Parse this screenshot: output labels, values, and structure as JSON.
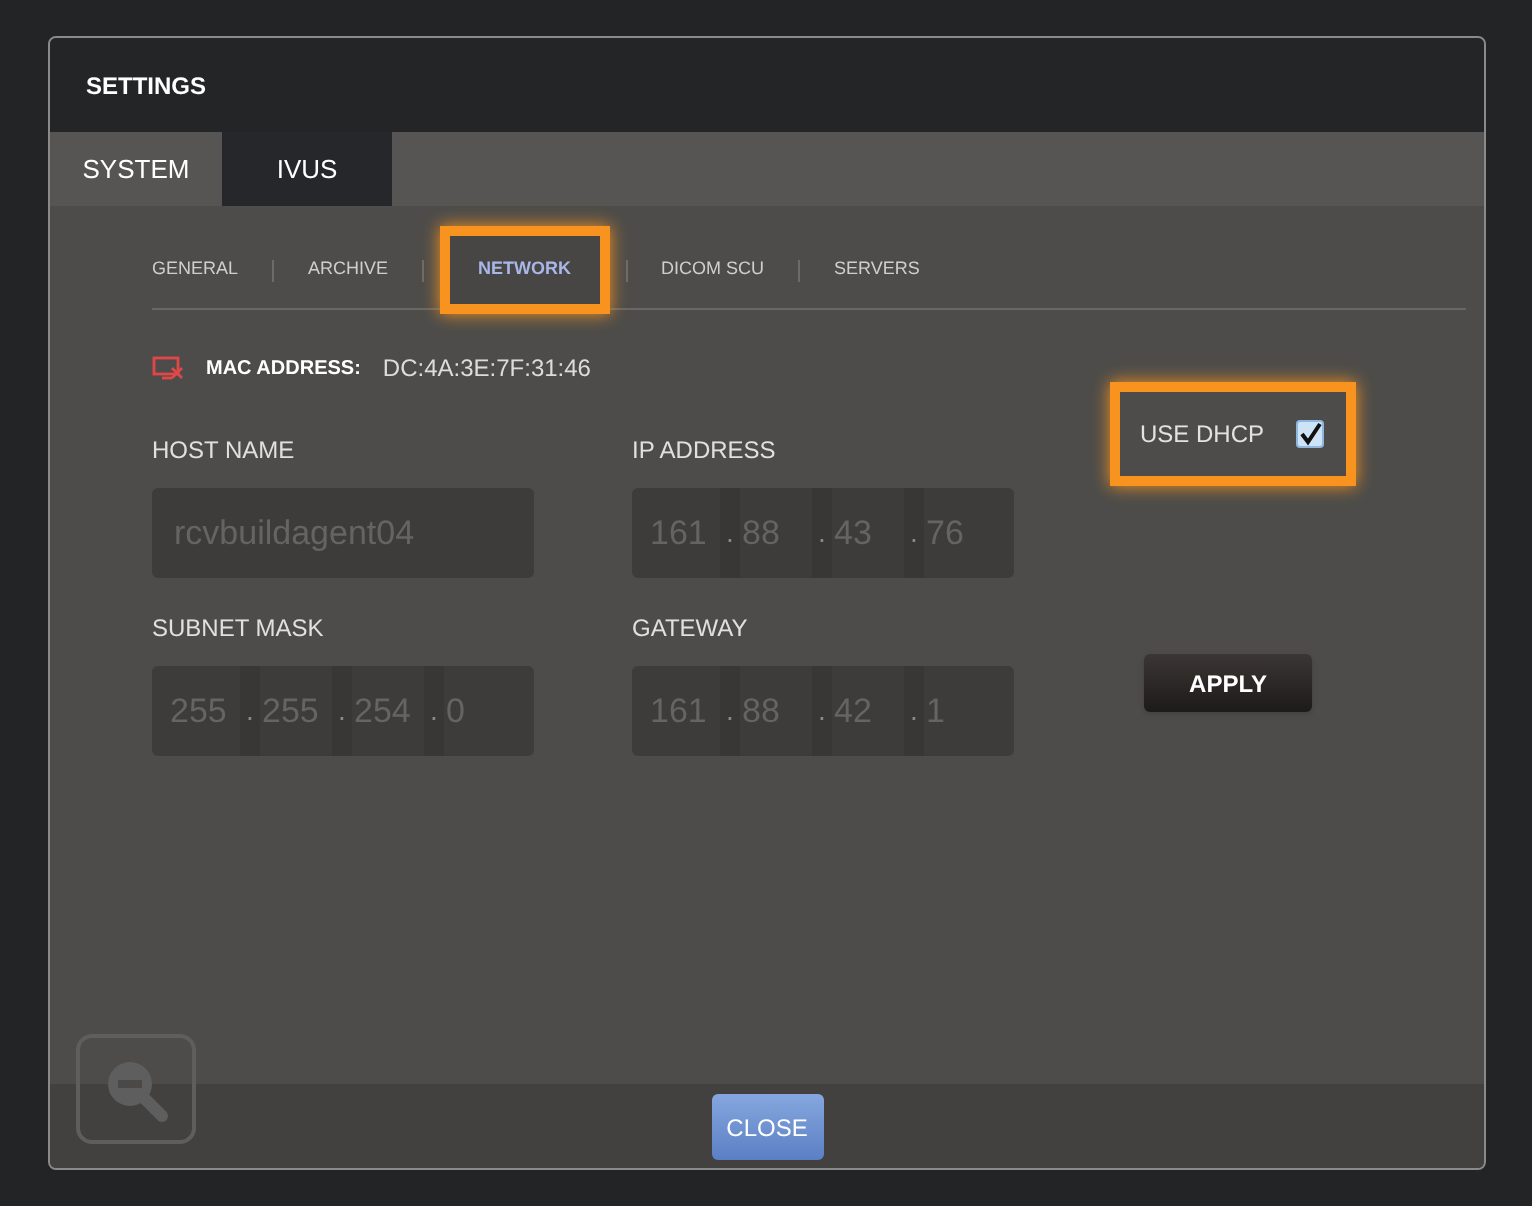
{
  "window": {
    "title": "SETTINGS"
  },
  "tabs": [
    {
      "label": "SYSTEM",
      "selected": false
    },
    {
      "label": "IVUS",
      "selected": true
    }
  ],
  "subtabs": [
    {
      "label": "GENERAL",
      "selected": false,
      "highlighted": false
    },
    {
      "label": "ARCHIVE",
      "selected": false,
      "highlighted": false
    },
    {
      "label": "NETWORK",
      "selected": true,
      "highlighted": true
    },
    {
      "label": "DICOM SCU",
      "selected": false,
      "highlighted": false
    },
    {
      "label": "SERVERS",
      "selected": false,
      "highlighted": false
    }
  ],
  "mac": {
    "label": "MAC ADDRESS:",
    "value": "DC:4A:3E:7F:31:46"
  },
  "octet_separator": ".",
  "fields": [
    {
      "label": "HOST NAME",
      "kind": "text",
      "value": "rcvbuildagent04"
    },
    {
      "label": "IP ADDRESS",
      "kind": "ip",
      "octets": [
        "161",
        "88",
        "43",
        "76"
      ]
    },
    {
      "label": "SUBNET MASK",
      "kind": "ip",
      "octets": [
        "255",
        "255",
        "254",
        "0"
      ]
    },
    {
      "label": "GATEWAY",
      "kind": "ip",
      "octets": [
        "161",
        "88",
        "42",
        "1"
      ]
    }
  ],
  "dhcp": {
    "label": "USE DHCP",
    "checked": true,
    "highlighted": true
  },
  "apply_button": "APPLY",
  "close_button": "CLOSE"
}
